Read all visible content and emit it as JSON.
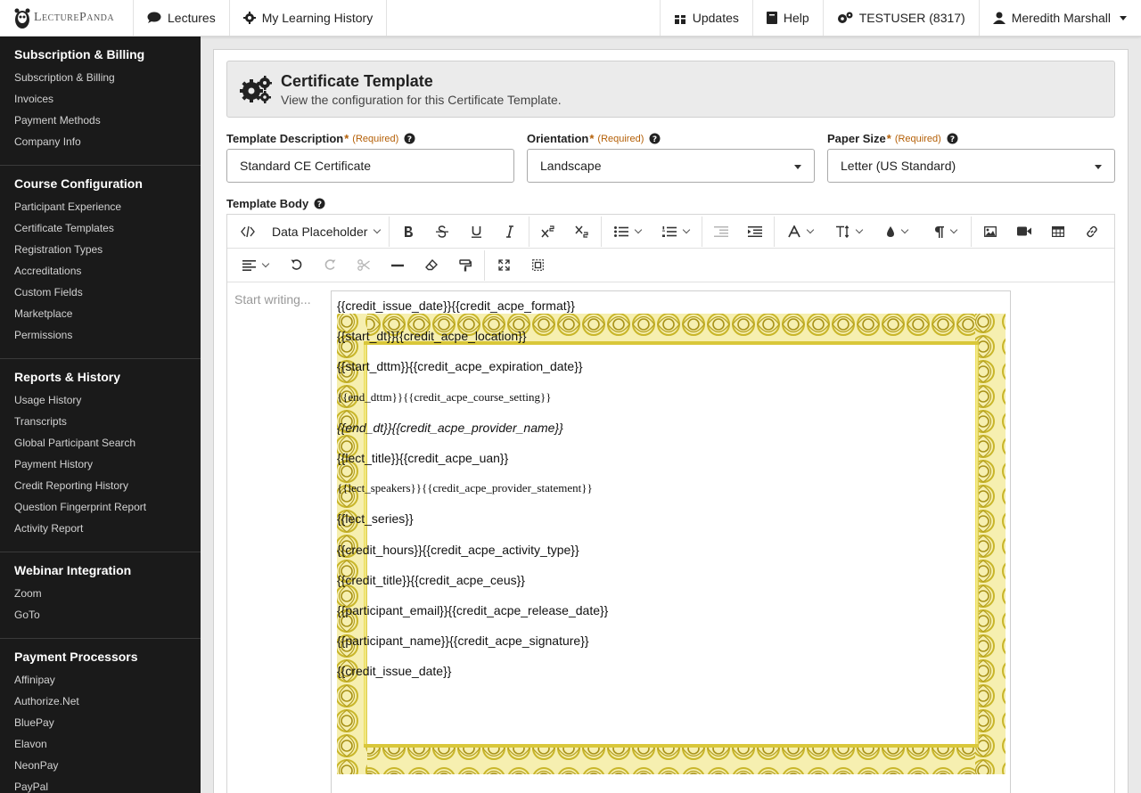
{
  "brand": {
    "name": "LecturePanda"
  },
  "topnav": {
    "lectures": "Lectures",
    "history": "My Learning History",
    "updates": "Updates",
    "help": "Help",
    "account": "TESTUSER (8317)",
    "user": "Meredith Marshall"
  },
  "sidebar": {
    "sections": [
      {
        "heading": "Subscription & Billing",
        "items": [
          "Subscription & Billing",
          "Invoices",
          "Payment Methods",
          "Company Info"
        ]
      },
      {
        "heading": "Course Configuration",
        "items": [
          "Participant Experience",
          "Certificate Templates",
          "Registration Types",
          "Accreditations",
          "Custom Fields",
          "Marketplace",
          "Permissions"
        ]
      },
      {
        "heading": "Reports & History",
        "items": [
          "Usage History",
          "Transcripts",
          "Global Participant Search",
          "Payment History",
          "Credit Reporting History",
          "Question Fingerprint Report",
          "Activity Report"
        ]
      },
      {
        "heading": "Webinar Integration",
        "items": [
          "Zoom",
          "GoTo"
        ]
      },
      {
        "heading": "Payment Processors",
        "items": [
          "Affinipay",
          "Authorize.Net",
          "BluePay",
          "Elavon",
          "NeonPay",
          "PayPal"
        ]
      }
    ]
  },
  "header": {
    "title": "Certificate Template",
    "subtitle": "View the configuration for this Certificate Template."
  },
  "form": {
    "required_star": "*",
    "required_text": "(Required)",
    "description": {
      "label": "Template Description",
      "value": "Standard CE Certificate"
    },
    "orientation": {
      "label": "Orientation",
      "value": "Landscape"
    },
    "paper": {
      "label": "Paper Size",
      "value": "Letter (US Standard)"
    },
    "body": {
      "label": "Template Body"
    }
  },
  "editor": {
    "placeholder_dropdown": "Data Placeholder",
    "empty_placeholder": "Start writing...",
    "lines": [
      "{{credit_issue_date}}{{credit_acpe_format}}",
      "{{start_dt}}{{credit_acpe_location}}",
      "{{start_dttm}}{{credit_acpe_expiration_date}}",
      "{{end_dttm}}{{credit_acpe_course_setting}}",
      "{{end_dt}}{{credit_acpe_provider_name}}",
      "{{lect_title}}{{credit_acpe_uan}}",
      "{{lect_speakers}}{{credit_acpe_provider_statement}}",
      "{{lect_series}}",
      "{{credit_hours}}{{credit_acpe_activity_type}}",
      "{{credit_title}}{{credit_acpe_ceus}}",
      "{{participant_email}}{{credit_acpe_release_date}}",
      "{{participant_name}}{{credit_acpe_signature}}",
      "{{credit_issue_date}}"
    ]
  },
  "colors": {
    "sidebar_bg": "#1a1a1a",
    "required": "#b45f06",
    "border_gold": "#c9b62a"
  }
}
